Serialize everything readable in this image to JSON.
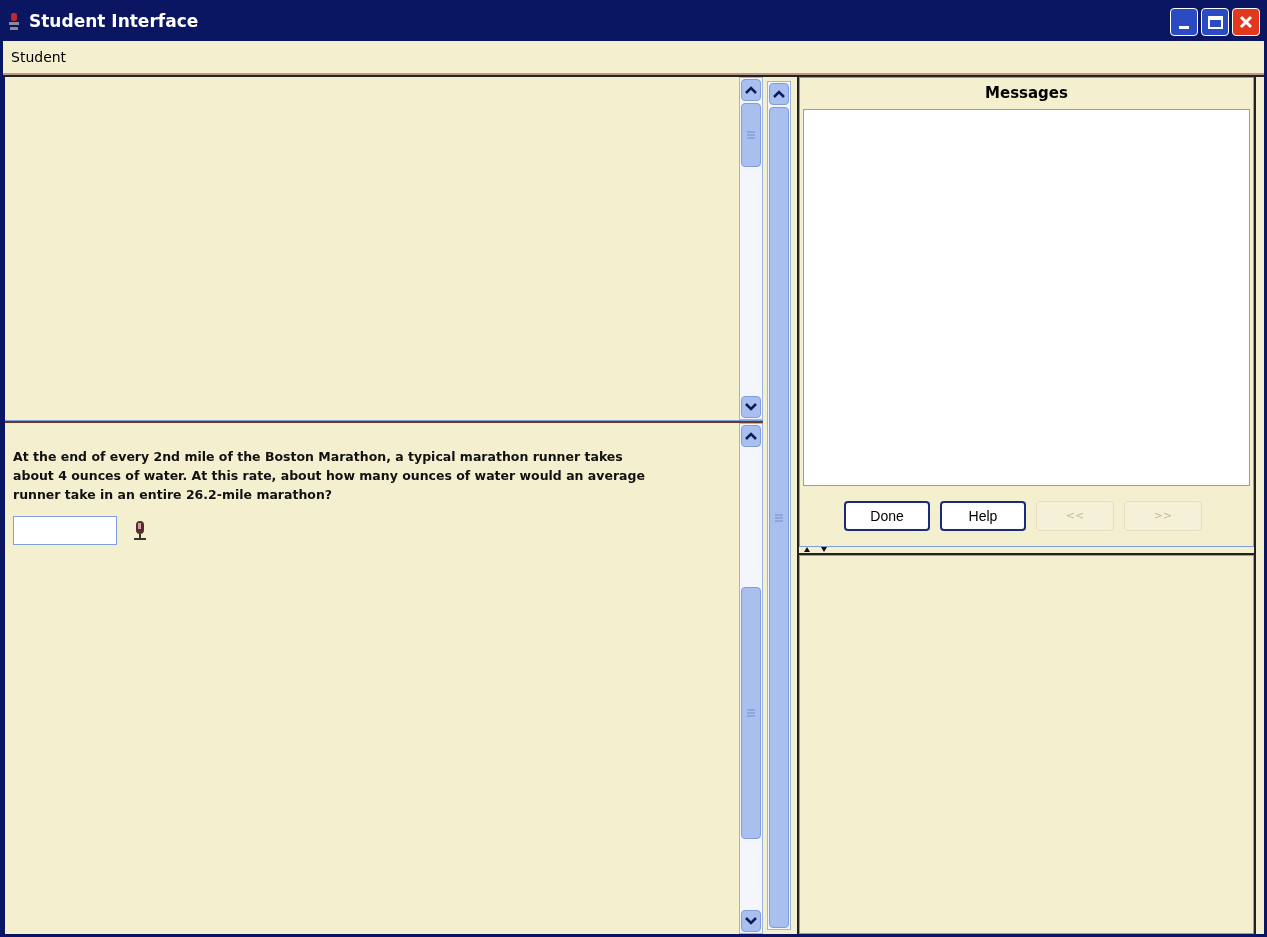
{
  "window": {
    "title": "Student Interface"
  },
  "menu_bar": {
    "items": [
      "Student"
    ]
  },
  "problem": {
    "text": "At the end of every 2nd mile of the Boston Marathon, a typical marathon runner takes about 4 ounces of water. At this rate, about how many ounces of water would an average runner take in an entire 26.2-mile marathon?"
  },
  "messages": {
    "title": "Messages"
  },
  "buttons": [
    {
      "label": "Done",
      "disabled": false
    },
    {
      "label": "Help",
      "disabled": false
    },
    {
      "label": "<<",
      "disabled": true
    },
    {
      "label": ">>",
      "disabled": true
    }
  ]
}
